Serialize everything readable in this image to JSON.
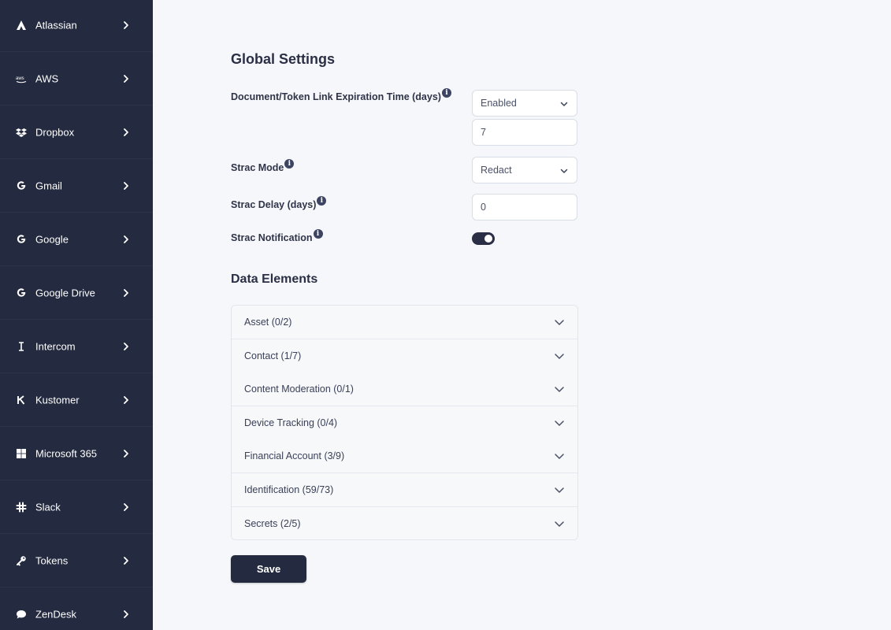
{
  "sidebar": {
    "items": [
      {
        "label": "Atlassian",
        "icon": "atlassian-icon"
      },
      {
        "label": "AWS",
        "icon": "aws-icon"
      },
      {
        "label": "Dropbox",
        "icon": "dropbox-icon"
      },
      {
        "label": "Gmail",
        "icon": "gmail-icon"
      },
      {
        "label": "Google",
        "icon": "google-icon"
      },
      {
        "label": "Google Drive",
        "icon": "google-drive-icon"
      },
      {
        "label": "Intercom",
        "icon": "intercom-icon"
      },
      {
        "label": "Kustomer",
        "icon": "kustomer-icon"
      },
      {
        "label": "Microsoft 365",
        "icon": "microsoft-icon"
      },
      {
        "label": "Slack",
        "icon": "slack-icon"
      },
      {
        "label": "Tokens",
        "icon": "key-icon"
      },
      {
        "label": "ZenDesk",
        "icon": "zendesk-icon"
      }
    ]
  },
  "global_settings": {
    "title": "Global Settings",
    "expiration": {
      "label": "Document/Token Link Expiration Time (days)",
      "select_value": "Enabled",
      "input_value": "7"
    },
    "strac_mode": {
      "label": "Strac Mode",
      "select_value": "Redact"
    },
    "strac_delay": {
      "label": "Strac Delay (days)",
      "input_value": "0"
    },
    "strac_notification": {
      "label": "Strac Notification",
      "enabled": true
    }
  },
  "data_elements": {
    "title": "Data Elements",
    "items": [
      "Asset (0/2)",
      "Contact (1/7)",
      "Content Moderation (0/1)",
      "Device Tracking (0/4)",
      "Financial Account (3/9)",
      "Identification (59/73)",
      "Secrets (2/5)"
    ]
  },
  "save_label": "Save",
  "colors": {
    "sidebar_bg": "#242a3f",
    "page_bg": "#f5f7fa",
    "accent": "#2a2f45"
  }
}
